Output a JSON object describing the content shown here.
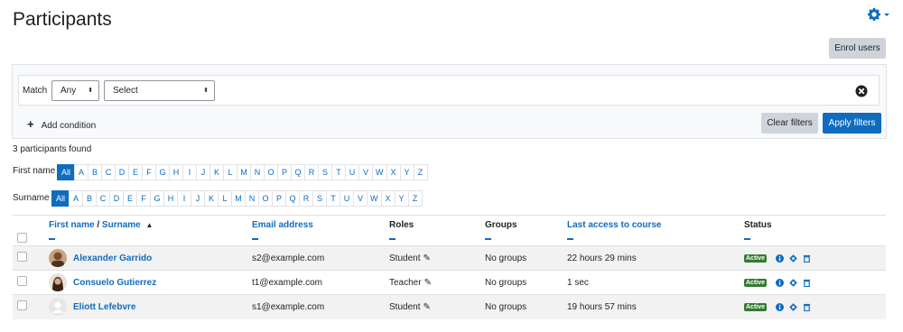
{
  "header": {
    "title": "Participants",
    "enrol_label": "Enrol users",
    "gear_icon": "gear-icon"
  },
  "filters": {
    "match_label": "Match",
    "match_value": "Any",
    "type_value": "Select",
    "add_condition": "Add condition",
    "clear_label": "Clear filters",
    "apply_label": "Apply filters"
  },
  "summary": {
    "found": "3 participants found"
  },
  "initials": {
    "firstname_label": "First name",
    "surname_label": "Surname",
    "letters": [
      "All",
      "A",
      "B",
      "C",
      "D",
      "E",
      "F",
      "G",
      "H",
      "I",
      "J",
      "K",
      "L",
      "M",
      "N",
      "O",
      "P",
      "Q",
      "R",
      "S",
      "T",
      "U",
      "V",
      "W",
      "X",
      "Y",
      "Z"
    ]
  },
  "table": {
    "headers": {
      "firstname": "First name",
      "separator": " / ",
      "surname": "Surname",
      "email": "Email address",
      "roles": "Roles",
      "groups": "Groups",
      "lastaccess": "Last access to course",
      "status": "Status"
    },
    "rows": [
      {
        "name": "Alexander Garrido",
        "email": "s2@example.com",
        "role": "Student",
        "groups": "No groups",
        "lastaccess": "22 hours 29 mins",
        "status": "Active"
      },
      {
        "name": "Consuelo Gutierrez",
        "email": "t1@example.com",
        "role": "Teacher",
        "groups": "No groups",
        "lastaccess": "1 sec",
        "status": "Active"
      },
      {
        "name": "Eliott Lefebvre",
        "email": "s1@example.com",
        "role": "Student",
        "groups": "No groups",
        "lastaccess": "19 hours 57 mins",
        "status": "Active"
      }
    ]
  },
  "colors": {
    "accent": "#0f6cbf",
    "active_badge": "#357a32"
  }
}
